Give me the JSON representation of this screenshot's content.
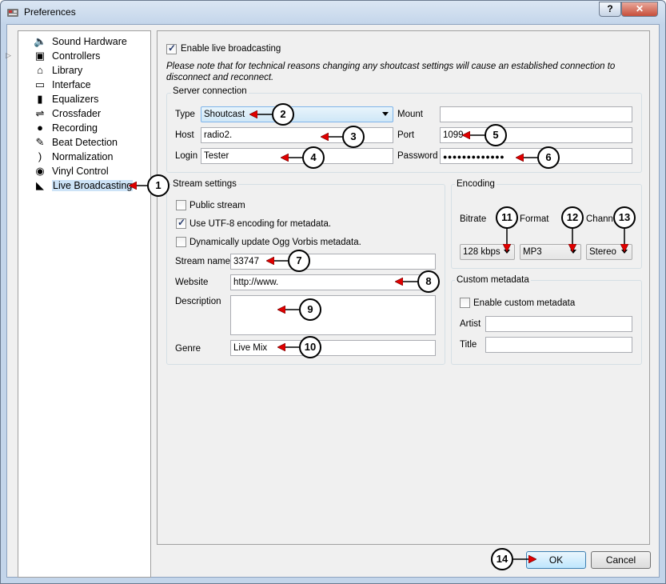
{
  "window": {
    "title": "Preferences",
    "help_label": "?",
    "close_label": "✕"
  },
  "sidebar": {
    "items": [
      {
        "label": "Sound Hardware",
        "icon": "speaker-icon"
      },
      {
        "label": "Controllers",
        "icon": "controller-icon"
      },
      {
        "label": "Library",
        "icon": "library-icon"
      },
      {
        "label": "Interface",
        "icon": "monitor-icon"
      },
      {
        "label": "Equalizers",
        "icon": "equalizer-icon"
      },
      {
        "label": "Crossfader",
        "icon": "crossfader-icon"
      },
      {
        "label": "Recording",
        "icon": "recording-icon"
      },
      {
        "label": "Beat Detection",
        "icon": "beat-detection-icon"
      },
      {
        "label": "Normalization",
        "icon": "normalization-icon"
      },
      {
        "label": "Vinyl Control",
        "icon": "vinyl-icon"
      },
      {
        "label": "Live Broadcasting",
        "icon": "broadcast-icon",
        "selected": true
      }
    ]
  },
  "main": {
    "enable_label": "Enable live broadcasting",
    "enable_checked": true,
    "note": "Please note that for technical reasons changing any shoutcast settings will cause an established connection to disconnect and reconnect.",
    "server": {
      "title": "Server connection",
      "type_label": "Type",
      "type_value": "Shoutcast",
      "mount_label": "Mount",
      "mount_value": "",
      "host_label": "Host",
      "host_value": "radio2.",
      "port_label": "Port",
      "port_value": "1099",
      "login_label": "Login",
      "login_value": "Tester",
      "password_label": "Password",
      "password_value": "●●●●●●●●●●●●●"
    },
    "stream": {
      "title": "Stream settings",
      "public_label": "Public stream",
      "public_checked": false,
      "utf8_label": "Use UTF-8 encoding for metadata.",
      "utf8_checked": true,
      "ogg_label": "Dynamically update Ogg Vorbis metadata.",
      "ogg_checked": false,
      "name_label": "Stream name",
      "name_value": "33747",
      "website_label": "Website",
      "website_value": "http://www.",
      "description_label": "Description",
      "description_value": "",
      "genre_label": "Genre",
      "genre_value": "Live Mix"
    },
    "encoding": {
      "title": "Encoding",
      "bitrate_label": "Bitrate",
      "bitrate_value": "128 kbps",
      "format_label": "Format",
      "format_value": "MP3",
      "channels_label": "Chann",
      "channels_value": "Stereo"
    },
    "custom": {
      "title": "Custom metadata",
      "enable_label": "Enable custom metadata",
      "enable_checked": false,
      "artist_label": "Artist",
      "artist_value": "",
      "title_label": "Title",
      "title_value": ""
    }
  },
  "footer": {
    "ok_label": "OK",
    "cancel_label": "Cancel"
  },
  "callouts": [
    "1",
    "2",
    "3",
    "4",
    "5",
    "6",
    "7",
    "8",
    "9",
    "10",
    "11",
    "12",
    "13",
    "14"
  ],
  "colors": {
    "arrow": "#e00000",
    "selection": "#cde3f7",
    "title_bar": "#c3d5ea",
    "close": "#c74e3a"
  }
}
